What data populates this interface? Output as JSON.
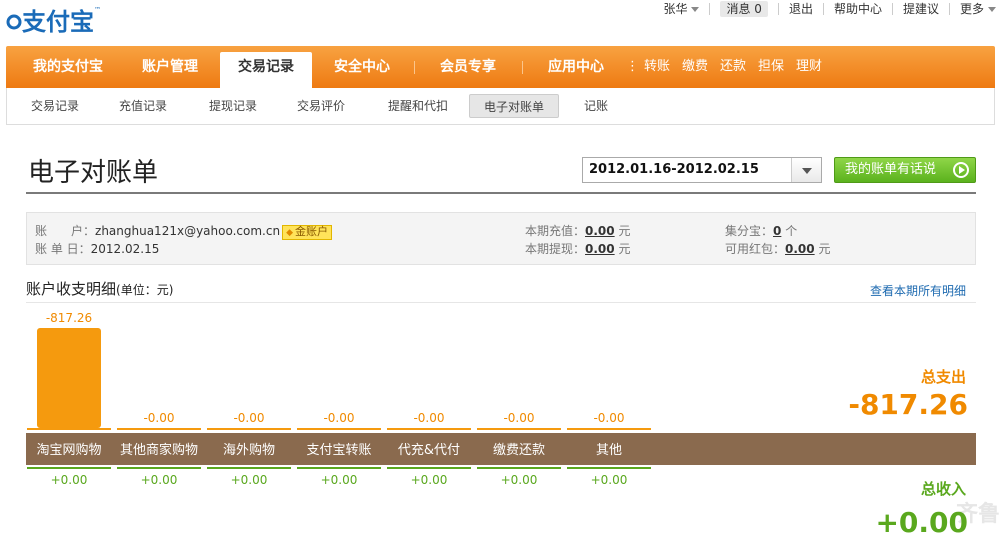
{
  "header": {
    "logo_text": "支付宝",
    "user_name": "张华",
    "messages_label": "消息",
    "messages_count": "0",
    "logout": "退出",
    "help": "帮助中心",
    "suggest": "提建议",
    "more": "更多"
  },
  "mainnav": {
    "items": [
      "我的支付宝",
      "账户管理",
      "交易记录",
      "安全中心",
      "会员专享",
      "应用中心"
    ],
    "active": "交易记录",
    "quick": [
      "转账",
      "缴费",
      "还款",
      "担保",
      "理财"
    ]
  },
  "subnav": {
    "items": [
      "交易记录",
      "充值记录",
      "提现记录",
      "交易评价",
      "提醒和代扣",
      "电子对账单",
      "记账"
    ],
    "active": "电子对账单"
  },
  "page": {
    "title": "电子对账单",
    "date_range": "2012.01.16-2012.02.15",
    "complain_button": "我的账单有话说"
  },
  "info": {
    "account_label": "账　　户：",
    "account_value": "zhanghua121x@yahoo.com.cn",
    "gold_badge": "金账户",
    "bill_date_label": "账 单 日：",
    "bill_date_value": "2012.02.15",
    "recharge_label": "本期充值：",
    "recharge_value": "0.00",
    "recharge_unit": "元",
    "withdraw_label": "本期提现：",
    "withdraw_value": "0.00",
    "withdraw_unit": "元",
    "points_label": "集分宝：",
    "points_value": "0",
    "points_unit": "个",
    "redpacket_label": "可用红包：",
    "redpacket_value": "0.00",
    "redpacket_unit": "元"
  },
  "section": {
    "title": "账户收支明细",
    "unit": "(单位：元)",
    "view_all": "查看本期所有明细"
  },
  "chart_data": {
    "type": "bar",
    "categories": [
      "淘宝网购物",
      "其他商家购物",
      "海外购物",
      "支付宝转账",
      "代充&代付",
      "缴费还款",
      "其他"
    ],
    "series": [
      {
        "name": "",
        "values": [
          -817.26,
          -0.0,
          -0.0,
          -0.0,
          -0.0,
          -0.0,
          -0.0
        ]
      },
      {
        "name": "",
        "values": [
          0.0,
          0.0,
          0.0,
          0.0,
          0.0,
          0.0,
          0.0
        ]
      }
    ],
    "expense_labels": [
      "-817.26",
      "-0.00",
      "-0.00",
      "-0.00",
      "-0.00",
      "-0.00",
      "-0.00"
    ],
    "income_labels": [
      "+0.00",
      "+0.00",
      "+0.00",
      "+0.00",
      "+0.00",
      "+0.00",
      "+0.00"
    ],
    "expense_color": "#f59a0e",
    "income_color": "#5aa81e",
    "title": "",
    "xlabel": "",
    "ylabel": ""
  },
  "totals": {
    "expense_label": "总支出",
    "expense_value": "-817.26",
    "income_label": "总收入",
    "income_value": "+0.00"
  },
  "watermark": "齐鲁"
}
